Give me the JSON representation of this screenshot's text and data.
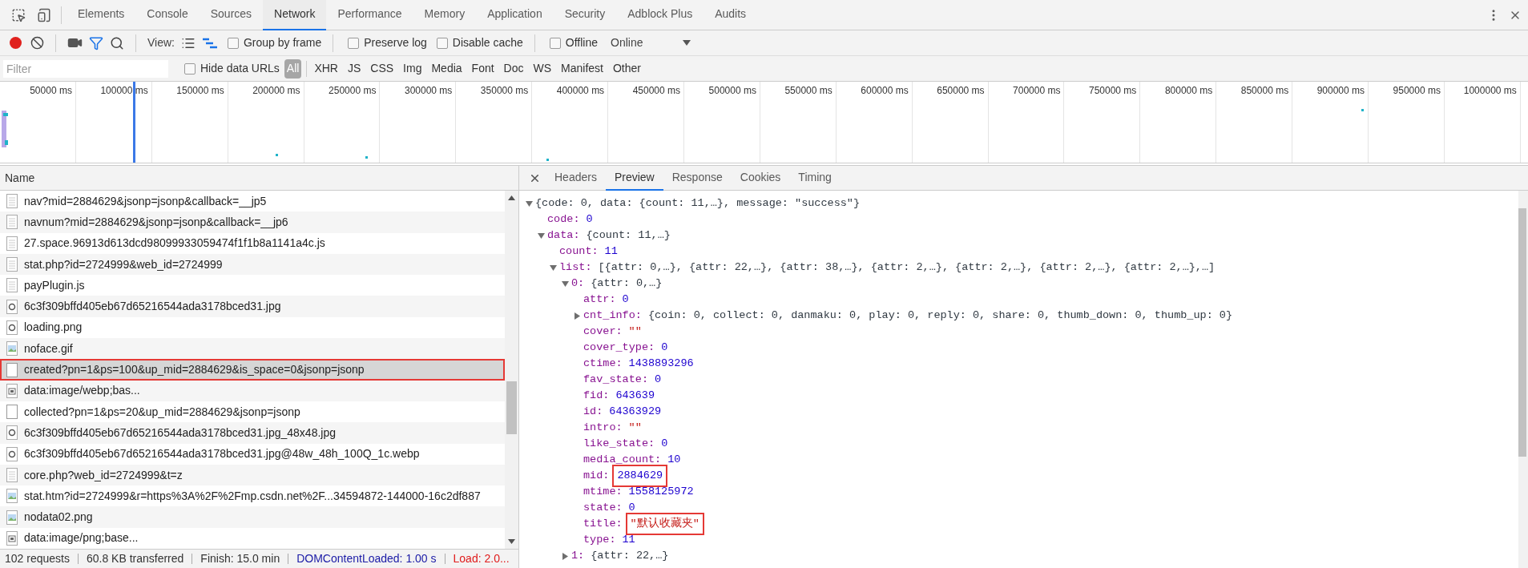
{
  "panel_tabs": [
    {
      "label": "Elements",
      "selected": false
    },
    {
      "label": "Console",
      "selected": false
    },
    {
      "label": "Sources",
      "selected": false
    },
    {
      "label": "Network",
      "selected": true
    },
    {
      "label": "Performance",
      "selected": false
    },
    {
      "label": "Memory",
      "selected": false
    },
    {
      "label": "Application",
      "selected": false
    },
    {
      "label": "Security",
      "selected": false
    },
    {
      "label": "Adblock Plus",
      "selected": false
    },
    {
      "label": "Audits",
      "selected": false
    }
  ],
  "toolbar": {
    "recording": true,
    "filter_active": true,
    "view_label": "View:",
    "large_rows": false,
    "overview": true,
    "checkboxes": [
      {
        "label": "Group by frame",
        "checked": false
      },
      {
        "label": "Preserve log",
        "checked": false
      },
      {
        "label": "Disable cache",
        "checked": false
      },
      {
        "label": "Offline",
        "checked": false
      }
    ],
    "throttling": "Online"
  },
  "filter_bar": {
    "placeholder": "Filter",
    "hide_data_urls": {
      "label": "Hide data URLs",
      "checked": false
    },
    "types": [
      {
        "label": "All",
        "selected": true
      },
      {
        "label": "XHR",
        "selected": false
      },
      {
        "label": "JS",
        "selected": false
      },
      {
        "label": "CSS",
        "selected": false
      },
      {
        "label": "Img",
        "selected": false
      },
      {
        "label": "Media",
        "selected": false
      },
      {
        "label": "Font",
        "selected": false
      },
      {
        "label": "Doc",
        "selected": false
      },
      {
        "label": "WS",
        "selected": false
      },
      {
        "label": "Manifest",
        "selected": false
      },
      {
        "label": "Other",
        "selected": false
      }
    ]
  },
  "timeline": {
    "ticks": [
      "50000 ms",
      "100000 ms",
      "150000 ms",
      "200000 ms",
      "250000 ms",
      "300000 ms",
      "350000 ms",
      "400000 ms",
      "450000 ms",
      "500000 ms",
      "550000 ms",
      "600000 ms",
      "650000 ms",
      "700000 ms",
      "750000 ms",
      "800000 ms",
      "850000 ms",
      "900000 ms",
      "950000 ms",
      "1000000 ms"
    ]
  },
  "requests": {
    "column": "Name",
    "rows": [
      {
        "name": "nav?mid=2884629&jsonp=jsonp&callback=__jp5",
        "kind": "script",
        "selected": false,
        "annotated": false
      },
      {
        "name": "navnum?mid=2884629&jsonp=jsonp&callback=__jp6",
        "kind": "script",
        "selected": false,
        "annotated": false
      },
      {
        "name": "27.space.96913d613dcd98099933059474f1f1b8a1141a4c.js",
        "kind": "script",
        "selected": false,
        "annotated": false
      },
      {
        "name": "stat.php?id=2724999&web_id=2724999",
        "kind": "script",
        "selected": false,
        "annotated": false
      },
      {
        "name": "payPlugin.js",
        "kind": "script",
        "selected": false,
        "annotated": false
      },
      {
        "name": "6c3f309bffd405eb67d65216544ada3178bced31.jpg",
        "kind": "image",
        "selected": false,
        "annotated": false
      },
      {
        "name": "loading.png",
        "kind": "image",
        "selected": false,
        "annotated": false
      },
      {
        "name": "noface.gif",
        "kind": "picture",
        "selected": false,
        "annotated": false
      },
      {
        "name": "created?pn=1&ps=100&up_mid=2884629&is_space=0&jsonp=jsonp",
        "kind": "xhr",
        "selected": true,
        "annotated": true
      },
      {
        "name": "data:image/webp;bas...",
        "kind": "data",
        "selected": false,
        "annotated": false
      },
      {
        "name": "collected?pn=1&ps=20&up_mid=2884629&jsonp=jsonp",
        "kind": "xhr",
        "selected": false,
        "annotated": false
      },
      {
        "name": "6c3f309bffd405eb67d65216544ada3178bced31.jpg_48x48.jpg",
        "kind": "image",
        "selected": false,
        "annotated": false
      },
      {
        "name": "6c3f309bffd405eb67d65216544ada3178bced31.jpg@48w_48h_100Q_1c.webp",
        "kind": "image",
        "selected": false,
        "annotated": false
      },
      {
        "name": "core.php?web_id=2724999&t=z",
        "kind": "script",
        "selected": false,
        "annotated": false
      },
      {
        "name": "stat.htm?id=2724999&r=https%3A%2F%2Fmp.csdn.net%2F...34594872-144000-16c2df887",
        "kind": "picture",
        "selected": false,
        "annotated": false
      },
      {
        "name": "nodata02.png",
        "kind": "picture",
        "selected": false,
        "annotated": false
      },
      {
        "name": "data:image/png;base...",
        "kind": "data",
        "selected": false,
        "annotated": false
      }
    ]
  },
  "status_bar": [
    {
      "text": "102 requests",
      "kind": "plain"
    },
    {
      "text": "60.8 KB transferred",
      "kind": "plain"
    },
    {
      "text": "Finish: 15.0 min",
      "kind": "plain"
    },
    {
      "text": "DOMContentLoaded: 1.00 s",
      "kind": "dom"
    },
    {
      "text": "Load: 2.0...",
      "kind": "load"
    }
  ],
  "detail_tabs": [
    {
      "label": "Headers",
      "selected": false
    },
    {
      "label": "Preview",
      "selected": true
    },
    {
      "label": "Response",
      "selected": false
    },
    {
      "label": "Cookies",
      "selected": false
    },
    {
      "label": "Timing",
      "selected": false
    }
  ],
  "preview": {
    "tree": [
      {
        "value": "{code: 0, data: {count: 11,…}, message: \"success\"}",
        "kind": "object",
        "expanded": true,
        "children": [
          {
            "key": "code:",
            "value": "0",
            "kind": "number"
          },
          {
            "key": "data:",
            "value": "{count: 11,…}",
            "kind": "object",
            "expanded": true,
            "children": [
              {
                "key": "count:",
                "value": "11",
                "kind": "number"
              },
              {
                "key": "list:",
                "value": "[{attr: 0,…}, {attr: 22,…}, {attr: 38,…}, {attr: 2,…}, {attr: 2,…}, {attr: 2,…}, {attr: 2,…},…]",
                "kind": "object",
                "expanded": true,
                "children": [
                  {
                    "key": "0:",
                    "value": "{attr: 0,…}",
                    "kind": "object",
                    "expanded": true,
                    "children": [
                      {
                        "key": "attr:",
                        "value": "0",
                        "kind": "number"
                      },
                      {
                        "key": "cnt_info:",
                        "value": "{coin: 0, collect: 0, danmaku: 0, play: 0, reply: 0, share: 0, thumb_down: 0, thumb_up: 0}",
                        "kind": "object",
                        "expanded": false
                      },
                      {
                        "key": "cover:",
                        "value": "\"\"",
                        "kind": "string"
                      },
                      {
                        "key": "cover_type:",
                        "value": "0",
                        "kind": "number"
                      },
                      {
                        "key": "ctime:",
                        "value": "1438893296",
                        "kind": "number"
                      },
                      {
                        "key": "fav_state:",
                        "value": "0",
                        "kind": "number"
                      },
                      {
                        "key": "fid:",
                        "value": "643639",
                        "kind": "number"
                      },
                      {
                        "key": "id:",
                        "value": "64363929",
                        "kind": "number"
                      },
                      {
                        "key": "intro:",
                        "value": "\"\"",
                        "kind": "string"
                      },
                      {
                        "key": "like_state:",
                        "value": "0",
                        "kind": "number"
                      },
                      {
                        "key": "media_count:",
                        "value": "10",
                        "kind": "number"
                      },
                      {
                        "key": "mid:",
                        "value": "2884629",
                        "kind": "number",
                        "annotated": true
                      },
                      {
                        "key": "mtime:",
                        "value": "1558125972",
                        "kind": "number"
                      },
                      {
                        "key": "state:",
                        "value": "0",
                        "kind": "number"
                      },
                      {
                        "key": "title:",
                        "value": "\"默认收藏夹\"",
                        "kind": "string",
                        "annotated": true
                      },
                      {
                        "key": "type:",
                        "value": "11",
                        "kind": "number"
                      }
                    ]
                  },
                  {
                    "key": "1:",
                    "value": "{attr: 22,…}",
                    "kind": "object",
                    "expanded": false
                  }
                ]
              }
            ]
          }
        ]
      }
    ]
  }
}
